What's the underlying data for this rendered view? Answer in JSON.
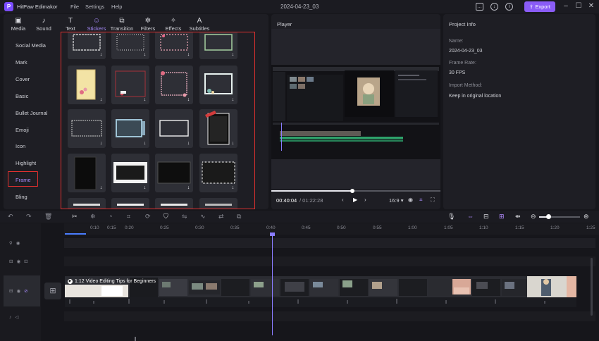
{
  "app": {
    "name": "HitPaw Edimakor",
    "logo_glyph": "P",
    "menus": [
      "File",
      "Settings",
      "Help"
    ],
    "project_name": "2024-04-23_03",
    "export_label": "Export",
    "accent": "#8a5cf6"
  },
  "titlebar_icons": [
    "feedback-icon",
    "download-icon",
    "info-icon"
  ],
  "tools": [
    {
      "icon": "media-icon",
      "glyph": "▣",
      "label": "Media"
    },
    {
      "icon": "sound-icon",
      "glyph": "♪",
      "label": "Sound"
    },
    {
      "icon": "text-icon",
      "glyph": "T",
      "label": "Text"
    },
    {
      "icon": "sticker-icon",
      "glyph": "☺",
      "label": "Stickers"
    },
    {
      "icon": "transition-icon",
      "glyph": "⧉",
      "label": "Transition"
    },
    {
      "icon": "filter-icon",
      "glyph": "✲",
      "label": "Filters"
    },
    {
      "icon": "effect-icon",
      "glyph": "✧",
      "label": "Effects"
    },
    {
      "icon": "subtitle-icon",
      "glyph": "A",
      "label": "Subtitles"
    }
  ],
  "categories": [
    "Social Media",
    "Mark",
    "Cover",
    "Basic",
    "Bullet Journal",
    "Emoji",
    "Icon",
    "Highlight",
    "Frame",
    "Bling"
  ],
  "active_category": "Frame",
  "player": {
    "title": "Player",
    "time_current": "00:40:04",
    "time_total": "/ 01:22:28",
    "progress": 0.48,
    "aspect": "16:9"
  },
  "project_info": {
    "title": "Project Info",
    "fields": [
      {
        "label": "Name:",
        "value": "2024-04-23_03"
      },
      {
        "label": "Frame Rate:",
        "value": "30 FPS"
      },
      {
        "label": "Import Method:",
        "value": "Keep in original location"
      }
    ]
  },
  "timeline": {
    "ticks": [
      "0:10",
      "0:15",
      "0:20",
      "0:25",
      "0:30",
      "0:35",
      "0:40",
      "0:45",
      "0:50",
      "0:55",
      "1:00",
      "1:05",
      "1:10",
      "1:15",
      "1:20",
      "1:25"
    ],
    "clip_title": "1:12 Video Editing Tips for Beginners"
  }
}
